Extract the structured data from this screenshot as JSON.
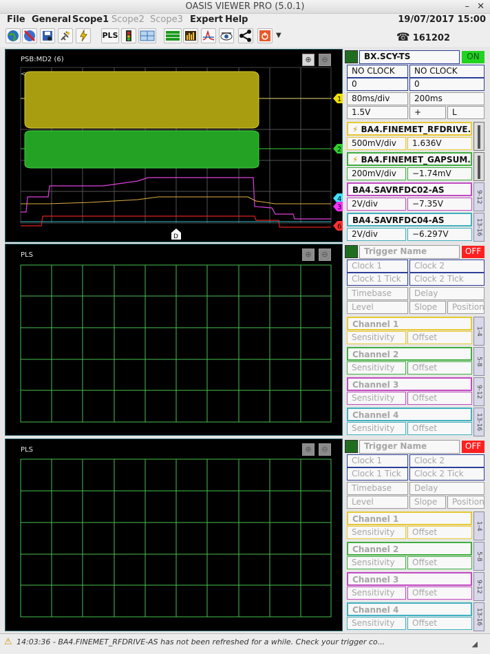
{
  "window": {
    "title": "OASIS VIEWER PRO (5.0.1)",
    "minimize": "–",
    "close": "✕"
  },
  "menu": {
    "items": [
      "File",
      "General",
      "Scope1",
      "Scope2",
      "Scope3",
      "Expert",
      "Help"
    ],
    "disabled": [
      false,
      false,
      false,
      true,
      true,
      false,
      false
    ],
    "datetime": "19/07/2017 15:00"
  },
  "toolbar": {
    "icons": [
      "globe-icon",
      "no-signal-icon",
      "save-icon",
      "plug-icon",
      "lightning-plug-icon",
      "pls-icon",
      "traffic-light-icon",
      "layout-icon",
      "green-bars-icon",
      "histogram-icon",
      "fft-icon",
      "eye-icon",
      "share-icon",
      "power-icon",
      "dropdown-arrow-icon"
    ],
    "pls_label": "PLS",
    "phone": "161202"
  },
  "scope1": {
    "label": "PSB:MD2 (6)",
    "marker": "D",
    "channel_markers": [
      "1",
      "2",
      "4",
      "3",
      "6"
    ],
    "marker_colors": [
      "#f0e000",
      "#30d030",
      "#40e0ff",
      "#ff30ff",
      "#ff3030"
    ],
    "side": {
      "name": "BX.SCY-TS",
      "state": "ON",
      "state_color": "#1fd31f",
      "clock1": "NO CLOCK",
      "clock2": "NO CLOCK",
      "tick1": "0",
      "tick2": "0",
      "timebase": "80ms/div",
      "delay": "200ms",
      "level": "1.5V",
      "slope": "+",
      "position": "L",
      "channels": [
        {
          "name": "BA4.FINEMET_RFDRIVE...",
          "sens": "500mV/div",
          "offset": "1.636V",
          "color": "#e8c830"
        },
        {
          "name": "BA4.FINEMET_GAPSUM...",
          "sens": "200mV/div",
          "offset": "−1.74mV",
          "color": "#3fae3f"
        },
        {
          "name": "BA4.SAVRFDC02-AS",
          "sens": "2V/div",
          "offset": "−7.35V",
          "color": "#c24ac2"
        },
        {
          "name": "BA4.SAVRFDC04-AS",
          "sens": "2V/div",
          "offset": "−6.297V",
          "color": "#40b0c0"
        }
      ],
      "tabs": [
        "9-12",
        "13-16"
      ]
    }
  },
  "empty_scope": {
    "label": "PLS",
    "trigger_name": "Trigger Name",
    "state": "OFF",
    "state_color": "#ff2020",
    "clock1": "Clock 1",
    "clock2": "Clock 2",
    "tick1": "Clock 1 Tick",
    "tick2": "Clock 2 Tick",
    "timebase": "Timebase",
    "delay": "Delay",
    "level": "Level",
    "slope": "Slope",
    "position": "Position",
    "channels": [
      {
        "name": "Channel 1",
        "color": "#e8c830",
        "tab": "1-4"
      },
      {
        "name": "Channel 2",
        "color": "#3fae3f",
        "tab": "5-8"
      },
      {
        "name": "Channel 3",
        "color": "#c24ac2",
        "tab": "9-12"
      },
      {
        "name": "Channel 4",
        "color": "#40b0c0",
        "tab": "13-16"
      }
    ],
    "sens": "Sensitivity",
    "offset": "Offset"
  },
  "status": {
    "text": "14:03:36 - BA4.FINEMET_RFDRIVE-AS has not been refreshed for a while. Check your trigger co...",
    "resize": "◢"
  }
}
